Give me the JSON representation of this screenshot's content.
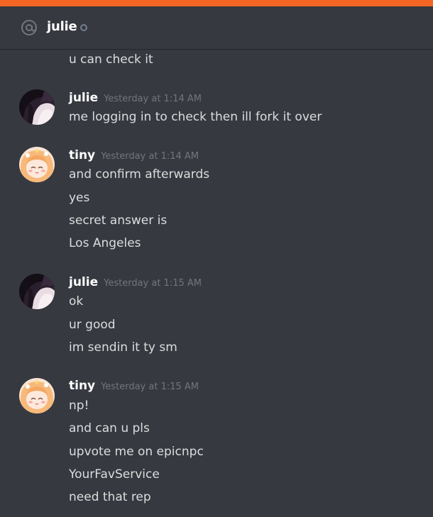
{
  "header": {
    "icon": "at-icon",
    "title": "julie",
    "status": "offline"
  },
  "colors": {
    "accent_bar": "#f26522",
    "background": "#36393f",
    "text": "#dcddde",
    "timestamp": "#72767d",
    "status_offline": "#747f8d"
  },
  "messages": {
    "orphan_line": "u can check it",
    "groups": [
      {
        "author": "julie",
        "timestamp": "Yesterday at 1:14 AM",
        "lines": [
          "me logging in to check then ill fork it over"
        ]
      },
      {
        "author": "tiny",
        "timestamp": "Yesterday at 1:14 AM",
        "lines": [
          "and confirm afterwards",
          "yes",
          "secret answer is",
          "Los Angeles"
        ]
      },
      {
        "author": "julie",
        "timestamp": "Yesterday at 1:15 AM",
        "lines": [
          "ok",
          "ur good",
          "im sendin it ty sm"
        ]
      },
      {
        "author": "tiny",
        "timestamp": "Yesterday at 1:15 AM",
        "lines": [
          "np!",
          "and can u pls",
          "upvote me on epicnpc",
          "YourFavService",
          "need that rep"
        ]
      }
    ]
  }
}
